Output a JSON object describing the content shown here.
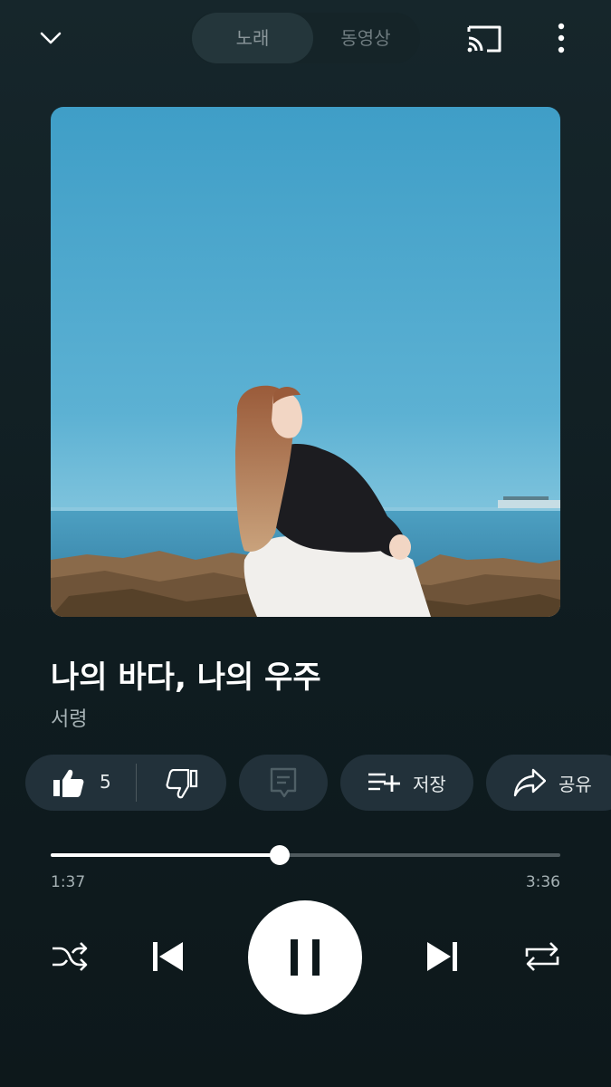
{
  "header": {
    "tabs": [
      {
        "label": "노래",
        "active": true
      },
      {
        "label": "동영상",
        "active": false
      }
    ],
    "icons": [
      "chevron-down-icon",
      "cast-icon",
      "more-vert-icon"
    ]
  },
  "song": {
    "title": "나의 바다, 나의 우주",
    "artist": "서령"
  },
  "actions": {
    "like_count": "5",
    "save_label": "저장",
    "share_label": "공유"
  },
  "progress": {
    "current": "1:37",
    "total": "3:36",
    "fraction": 0.449
  },
  "playback": {
    "state": "playing",
    "icons": [
      "shuffle-icon",
      "previous-icon",
      "pause-icon",
      "next-icon",
      "repeat-icon"
    ]
  },
  "colors": {
    "background": "#13232a",
    "pill": "#22313a",
    "accent": "#ffffff",
    "muted_text": "#a6b2b5"
  }
}
